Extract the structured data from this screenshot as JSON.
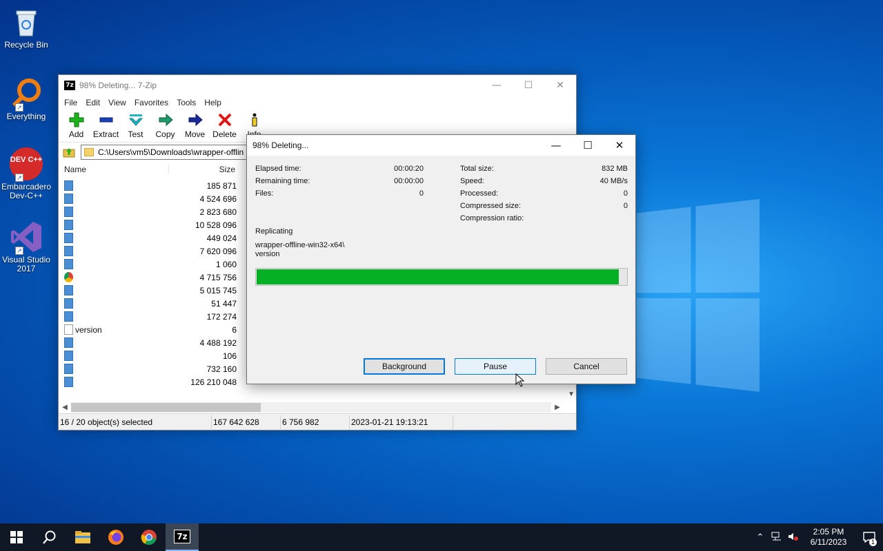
{
  "desktop": {
    "icons": [
      {
        "label": "Recycle Bin"
      },
      {
        "label": "Everything"
      },
      {
        "label": "Embarcadero Dev-C++"
      },
      {
        "label": "Visual Studio 2017"
      }
    ],
    "devcpp_logo": "DEV C++"
  },
  "main_window": {
    "title": "98% Deleting... 7-Zip",
    "app_icon": "7z",
    "menu": [
      "File",
      "Edit",
      "View",
      "Favorites",
      "Tools",
      "Help"
    ],
    "toolbar": [
      "Add",
      "Extract",
      "Test",
      "Copy",
      "Move",
      "Delete",
      "Info"
    ],
    "address": "C:\\Users\\vm5\\Downloads\\wrapper-offlin",
    "columns": {
      "name": "Name",
      "size": "Size"
    },
    "rows": [
      {
        "name": "",
        "size": "185 871",
        "icon": "file-icon"
      },
      {
        "name": "",
        "size": "4 524 696",
        "icon": "file-icon"
      },
      {
        "name": "",
        "size": "2 823 680",
        "icon": "file-icon"
      },
      {
        "name": "",
        "size": "10 528 096",
        "icon": "file-icon"
      },
      {
        "name": "",
        "size": "449 024",
        "icon": "file-icon"
      },
      {
        "name": "",
        "size": "7 620 096",
        "icon": "file-icon"
      },
      {
        "name": "",
        "size": "1 060",
        "icon": "file-icon"
      },
      {
        "name": "",
        "size": "4 715 756",
        "icon": "chrome-icon"
      },
      {
        "name": "",
        "size": "5 015 745",
        "icon": "file-icon"
      },
      {
        "name": "",
        "size": "51 447",
        "icon": "file-icon"
      },
      {
        "name": "",
        "size": "172 274",
        "icon": "file-icon"
      },
      {
        "name": "version",
        "size": "6",
        "icon": "text-file-icon"
      },
      {
        "name": "",
        "size": "4 488 192",
        "icon": "file-icon"
      },
      {
        "name": "",
        "size": "106",
        "icon": "file-icon"
      },
      {
        "name": "",
        "size": "732 160",
        "icon": "file-icon"
      },
      {
        "name": "",
        "size": "126 210 048",
        "icon": "file-icon"
      }
    ],
    "status": {
      "selected": "16 / 20 object(s) selected",
      "size": "167 642 628",
      "packed": "6 756 982",
      "modified": "2023-01-21 19:13:21"
    }
  },
  "progress_dialog": {
    "title": "98% Deleting...",
    "left_stats": [
      {
        "label": "Elapsed time:",
        "value": "00:00:20"
      },
      {
        "label": "Remaining time:",
        "value": "00:00:00"
      },
      {
        "label": "Files:",
        "value": "0"
      }
    ],
    "right_stats": [
      {
        "label": "Total size:",
        "value": "832 MB"
      },
      {
        "label": "Speed:",
        "value": "40 MB/s"
      },
      {
        "label": "Processed:",
        "value": "0"
      },
      {
        "label": "Compressed size:",
        "value": "0"
      },
      {
        "label": "Compression ratio:",
        "value": ""
      }
    ],
    "operation": "Replicating",
    "current_path": "wrapper-offline-win32-x64\\",
    "current_file": "version",
    "progress_percent": 98,
    "progress_color": "#06b025",
    "buttons": {
      "background": "Background",
      "pause": "Pause",
      "cancel": "Cancel"
    }
  },
  "taskbar": {
    "time": "2:05 PM",
    "date": "6/11/2023",
    "notifications": "1",
    "active_app": "7z"
  }
}
